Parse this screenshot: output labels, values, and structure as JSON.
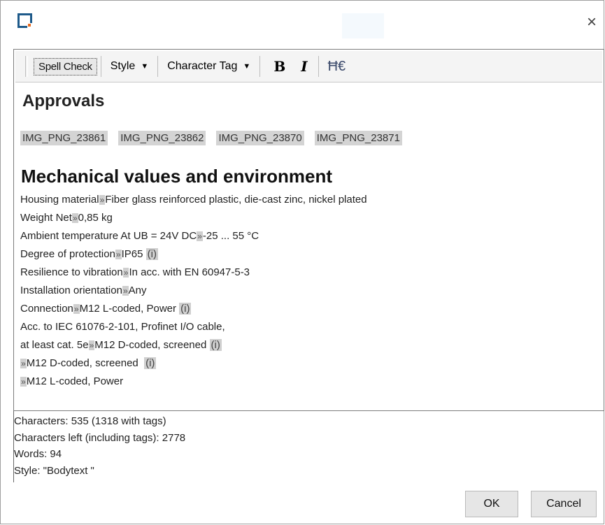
{
  "titlebar": {
    "close_label": "×"
  },
  "toolbar": {
    "spell_check": "Spell Check",
    "style_dropdown": "Style",
    "character_tag_dropdown": "Character Tag",
    "bold_label": "B",
    "italic_label": "I",
    "special_icon": "Ħ€"
  },
  "editor": {
    "heading_approvals": "Approvals",
    "images": [
      "IMG_PNG_23861",
      "IMG_PNG_23862",
      "IMG_PNG_23870",
      "IMG_PNG_23871"
    ],
    "heading_mechanical": "Mechanical values and environment",
    "lines": [
      {
        "pre": "Housing material",
        "tab": true,
        "post": "Fiber glass reinforced plastic, die-cast zinc, nickel plated",
        "info": ""
      },
      {
        "pre": "Weight Net",
        "tab": true,
        "post": "0,85 kg",
        "info": ""
      },
      {
        "pre": "Ambient temperature At UB = 24V DC",
        "tab": true,
        "post": "-25 ... 55 °C",
        "info": ""
      },
      {
        "pre": "Degree of protection",
        "tab": true,
        "post": "IP65 ",
        "info": "(i)"
      },
      {
        "pre": "Resilience to vibration",
        "tab": true,
        "post": "In acc. with EN 60947-5-3",
        "info": ""
      },
      {
        "pre": "Installation orientation",
        "tab": true,
        "post": "Any",
        "info": ""
      },
      {
        "pre": "Connection",
        "tab": true,
        "post": "M12 L-coded, Power ",
        "info": "(i)"
      },
      {
        "pre": "Acc. to IEC 61076-2-101, Profinet I/O cable,",
        "tab": false,
        "post": "",
        "info": ""
      },
      {
        "pre": "at least cat. 5e",
        "tab": true,
        "post": "M12 D-coded, screened ",
        "info": "(i)"
      },
      {
        "pre": "",
        "tab": true,
        "post": "M12 D-coded, screened  ",
        "info": "(i)"
      },
      {
        "pre": "",
        "tab": true,
        "post": "M12 L-coded, Power",
        "info": ""
      }
    ],
    "tab_glyph": "»"
  },
  "stats": {
    "characters": "Characters: 535 (1318 with tags)",
    "characters_left": "Characters left (including tags): 2778",
    "words": "Words: 94",
    "style": "Style: \"Bodytext \""
  },
  "buttons": {
    "ok": "OK",
    "cancel": "Cancel"
  },
  "colors": {
    "logo_blue": "#1e5a8a",
    "logo_orange": "#e86a1e",
    "tag_bg": "#d4d4d4"
  }
}
